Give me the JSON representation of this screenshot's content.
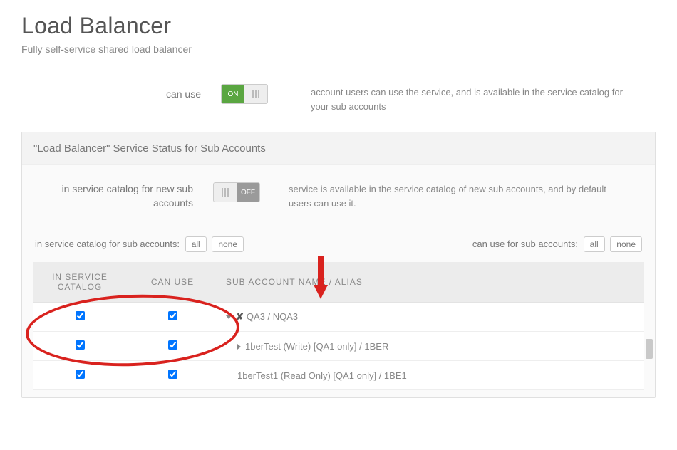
{
  "page": {
    "title": "Load Balancer",
    "subtitle": "Fully self-service shared load balancer"
  },
  "canUse": {
    "label": "can use",
    "toggleOnText": "ON",
    "desc": "account users can use the service, and is available in the service catalog for your sub accounts"
  },
  "panel": {
    "heading": "\"Load Balancer\" Service Status for Sub Accounts",
    "subLabel": "in service catalog for new sub accounts",
    "subToggleOffText": "OFF",
    "subDesc": "service is available in the service catalog of new sub accounts, and by default users can use it."
  },
  "filters": {
    "leftLabel": "in service catalog for sub accounts:",
    "rightLabel": "can use for sub accounts:",
    "allBtn": "all",
    "noneBtn": "none"
  },
  "table": {
    "headers": {
      "col1": "IN SERVICE CATALOG",
      "col2": "CAN USE",
      "col3": "SUB ACCOUNT NAME / ALIAS"
    },
    "rows": [
      {
        "inCatalog": true,
        "canUse": true,
        "expandable": true,
        "expanded": true,
        "hasX": true,
        "indent": 0,
        "name": "QA3 / NQA3"
      },
      {
        "inCatalog": true,
        "canUse": true,
        "expandable": true,
        "expanded": false,
        "hasX": false,
        "indent": 1,
        "name": "1berTest (Write) [QA1 only] / 1BER"
      },
      {
        "inCatalog": true,
        "canUse": true,
        "expandable": false,
        "expanded": false,
        "hasX": false,
        "indent": 1,
        "name": "1berTest1 (Read Only) [QA1 only] / 1BE1"
      }
    ]
  }
}
